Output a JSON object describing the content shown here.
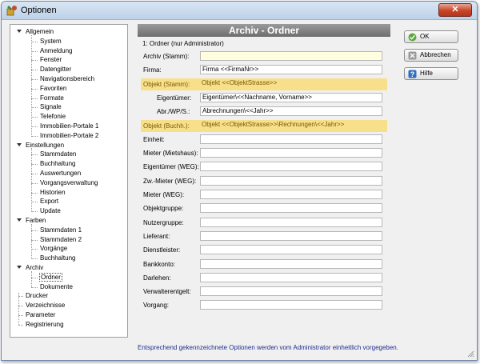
{
  "window": {
    "title": "Optionen",
    "close_label": "✕"
  },
  "tree": [
    {
      "label": "Allgemein",
      "level": 0,
      "expanded": true
    },
    {
      "label": "System",
      "level": 1
    },
    {
      "label": "Anmeldung",
      "level": 1
    },
    {
      "label": "Fenster",
      "level": 1
    },
    {
      "label": "Datengitter",
      "level": 1
    },
    {
      "label": "Navigationsbereich",
      "level": 1
    },
    {
      "label": "Favoriten",
      "level": 1
    },
    {
      "label": "Formate",
      "level": 1
    },
    {
      "label": "Signale",
      "level": 1
    },
    {
      "label": "Telefonie",
      "level": 1
    },
    {
      "label": "Immobilien-Portale 1",
      "level": 1
    },
    {
      "label": "Immobilien-Portale 2",
      "level": 1
    },
    {
      "label": "Einstellungen",
      "level": 0,
      "expanded": true
    },
    {
      "label": "Stammdaten",
      "level": 1
    },
    {
      "label": "Buchhaltung",
      "level": 1
    },
    {
      "label": "Auswertungen",
      "level": 1
    },
    {
      "label": "Vorgangsverwaltung",
      "level": 1
    },
    {
      "label": "Historien",
      "level": 1
    },
    {
      "label": "Export",
      "level": 1
    },
    {
      "label": "Update",
      "level": 1
    },
    {
      "label": "Farben",
      "level": 0,
      "expanded": true
    },
    {
      "label": "Stammdaten 1",
      "level": 1
    },
    {
      "label": "Stammdaten 2",
      "level": 1
    },
    {
      "label": "Vorgänge",
      "level": 1
    },
    {
      "label": "Buchhaltung",
      "level": 1
    },
    {
      "label": "Archiv",
      "level": 0,
      "expanded": true
    },
    {
      "label": "Ordner",
      "level": 1,
      "selected": true
    },
    {
      "label": "Dokumente",
      "level": 1
    },
    {
      "label": "Drucker",
      "level": 0
    },
    {
      "label": "Verzeichnisse",
      "level": 0
    },
    {
      "label": "Parameter",
      "level": 0
    },
    {
      "label": "Registrierung",
      "level": 0
    }
  ],
  "main": {
    "header": "Archiv - Ordner",
    "subtitle": "1: Ordner  (nur Administrator)",
    "rows": [
      {
        "label": "Archiv (Stamm):",
        "value": "",
        "highlight": false,
        "indent": false,
        "yellow_field": true
      },
      {
        "label": "Firma:",
        "value": "Firma <<FirmaNr>>",
        "highlight": false,
        "indent": false
      },
      {
        "label": "Objekt (Stamm):",
        "value": "Objekt <<ObjektStrasse>>",
        "highlight": true,
        "indent": false
      },
      {
        "label": "Eigentümer:",
        "value": "Eigentümer\\<<Nachname, Vorname>>",
        "highlight": false,
        "indent": true
      },
      {
        "label": "Abr./WP/S.:",
        "value": "Abrechnungen\\<<Jahr>>",
        "highlight": false,
        "indent": true
      },
      {
        "label": "Objekt (Buchh.):",
        "value": "Objekt <<ObjektStrasse>>\\Rechnungen\\<<Jahr>>",
        "highlight": true,
        "indent": false
      },
      {
        "label": "Einheit:",
        "value": "",
        "highlight": false,
        "indent": false
      },
      {
        "label": "Mieter (Mietshaus):",
        "value": "",
        "highlight": false,
        "indent": false
      },
      {
        "label": "Eigentümer (WEG):",
        "value": "",
        "highlight": false,
        "indent": false
      },
      {
        "label": "Zw.-Mieter (WEG):",
        "value": "",
        "highlight": false,
        "indent": false
      },
      {
        "label": "Mieter (WEG):",
        "value": "",
        "highlight": false,
        "indent": false
      },
      {
        "label": "Objektgruppe:",
        "value": "",
        "highlight": false,
        "indent": false
      },
      {
        "label": "Nutzergruppe:",
        "value": "",
        "highlight": false,
        "indent": false
      },
      {
        "label": "Lieferant:",
        "value": "",
        "highlight": false,
        "indent": false
      },
      {
        "label": "Dienstleister:",
        "value": "",
        "highlight": false,
        "indent": false
      },
      {
        "label": "Bankkonto:",
        "value": "",
        "highlight": false,
        "indent": false
      },
      {
        "label": "Darlehen:",
        "value": "",
        "highlight": false,
        "indent": false
      },
      {
        "label": "Verwalterentgelt:",
        "value": "",
        "highlight": false,
        "indent": false
      },
      {
        "label": "Vorgang:",
        "value": "",
        "highlight": false,
        "indent": false
      }
    ]
  },
  "buttons": {
    "ok": "OK",
    "cancel": "Abbrechen",
    "help": "Hilfe"
  },
  "footer": "Entsprechend gekennzeichnete Optionen werden vom Administrator einheitlich vorgegeben.",
  "colors": {
    "highlight": "#f7df8b",
    "footer_text": "#1f2d8e",
    "header_bar": "#7a7a7a"
  }
}
